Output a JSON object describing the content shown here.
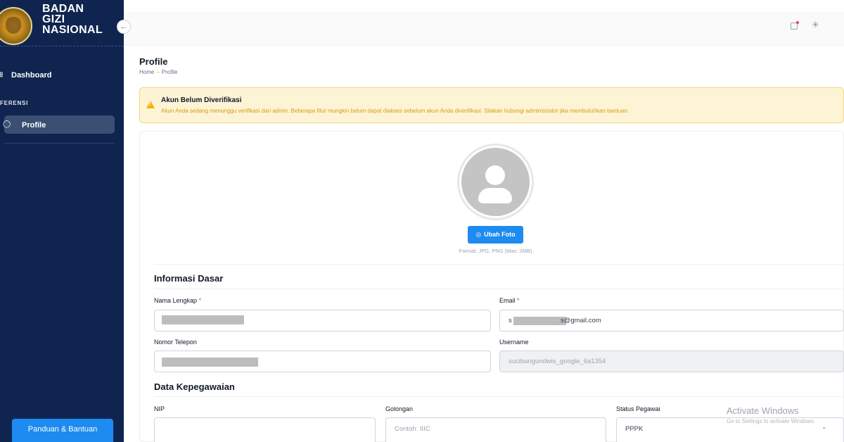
{
  "sidebar": {
    "logo_lines": [
      "BADAN",
      "GIZI",
      "NASIONAL"
    ],
    "collapse_icon": "arrow-left-icon",
    "items": [
      {
        "label": "Dashboard",
        "icon": "dashboard-icon"
      },
      {
        "label": "Profile",
        "icon": "user-icon",
        "active": true
      }
    ],
    "section_label": "FERENSI",
    "help_button": "Panduan & Bantuan"
  },
  "topbar": {
    "icons": [
      "notification-icon",
      "theme-sun-icon"
    ]
  },
  "page": {
    "title": "Profile",
    "breadcrumb": [
      "Home",
      "Profile"
    ],
    "breadcrumb_separator": "–"
  },
  "alert": {
    "title": "Akun Belum Diverifikasi",
    "message": "Akun Anda sedang menunggu verifikasi dari admin. Beberapa fitur mungkin belum dapat diakses sebelum akun Anda diverifikasi. Silakan hubungi administrator jika membutuhkan bantuan.",
    "color": "#f0b400"
  },
  "photo": {
    "button_label": "Ubah Foto",
    "hint": "Format: JPG, PNG (Max: 2MB)"
  },
  "informasi_dasar": {
    "title": "Informasi Dasar",
    "nama_label": "Nama Lengkap",
    "email_label": "Email",
    "email_value_prefix": "s",
    "email_value_suffix": "s@gmail.com",
    "telepon_label": "Nomor Telepon",
    "username_label": "Username",
    "username_value": "sucibangundwis_google_6a1354",
    "required_mark": "*"
  },
  "kepegawaian": {
    "title": "Data Kepegawaian",
    "nip_label": "NIP",
    "golongan_label": "Golongan",
    "golongan_placeholder": "Contoh: IIIC",
    "status_label": "Status Pegawai",
    "status_value": "PPPK"
  },
  "watermark": {
    "line1": "Activate Windows",
    "line2": "Go to Settings to activate Windows."
  },
  "colors": {
    "sidebar_bg": "#0f2550",
    "accent": "#1d8bf0"
  }
}
